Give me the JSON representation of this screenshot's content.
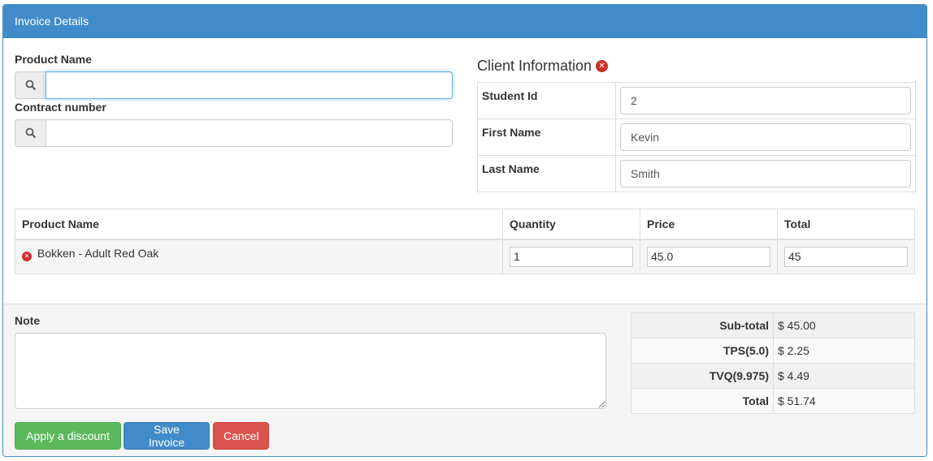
{
  "panel": {
    "title": "Invoice Details"
  },
  "search": {
    "product_label": "Product Name",
    "product_value": "",
    "contract_label": "Contract number",
    "contract_value": ""
  },
  "client": {
    "title": "Client Information",
    "fields": [
      {
        "label": "Student Id",
        "value": "2"
      },
      {
        "label": "First Name",
        "value": "Kevin"
      },
      {
        "label": "Last Name",
        "value": "Smith"
      }
    ]
  },
  "products": {
    "headers": [
      "Product Name",
      "Quantity",
      "Price",
      "Total"
    ],
    "rows": [
      {
        "name": "Bokken - Adult Red Oak",
        "quantity": "1",
        "price": "45.0",
        "total": "45"
      }
    ]
  },
  "note": {
    "label": "Note",
    "value": ""
  },
  "totals": [
    {
      "label": "Sub-total",
      "value": "$ 45.00"
    },
    {
      "label": "TPS(5.0)",
      "value": "$ 2.25"
    },
    {
      "label": "TVQ(9.975)",
      "value": "$ 4.49"
    },
    {
      "label": "Total",
      "value": "$ 51.74"
    }
  ],
  "buttons": {
    "discount": "Apply a discount",
    "save": "Save Invoice",
    "cancel": "Cancel"
  },
  "colors": {
    "primary": "#428bca",
    "success": "#5cb85c",
    "danger": "#d9534f",
    "remove": "#c9302c"
  },
  "icons": {
    "search": "search-icon",
    "remove": "remove-circle-icon"
  }
}
